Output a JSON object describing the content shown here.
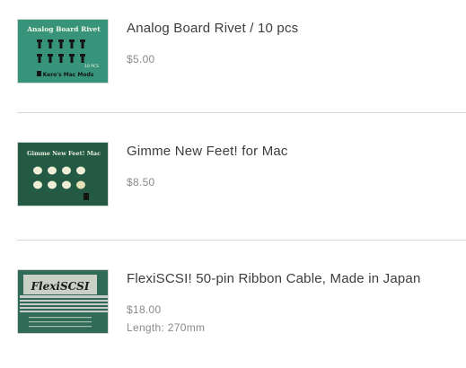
{
  "items": [
    {
      "name": "Analog Board Rivet / 10 pcs",
      "price": "$5.00",
      "image": {
        "title": "Analog Board Rivet",
        "count": "10 PCS",
        "brand": "Kero's Mac Mods",
        "bg_color": "#3c9a80"
      }
    },
    {
      "name": "Gimme New Feet! for Mac",
      "price": "$8.50",
      "image": {
        "title": "Gimme New Feet! Mac",
        "bg_color": "#245a44"
      }
    },
    {
      "name": "FlexiSCSI! 50-pin Ribbon Cable, Made in Japan",
      "price": "$18.00",
      "option": "Length: 270mm",
      "image": {
        "title": "FlexiSCSI",
        "bg_color": "#2f6b56"
      }
    }
  ]
}
